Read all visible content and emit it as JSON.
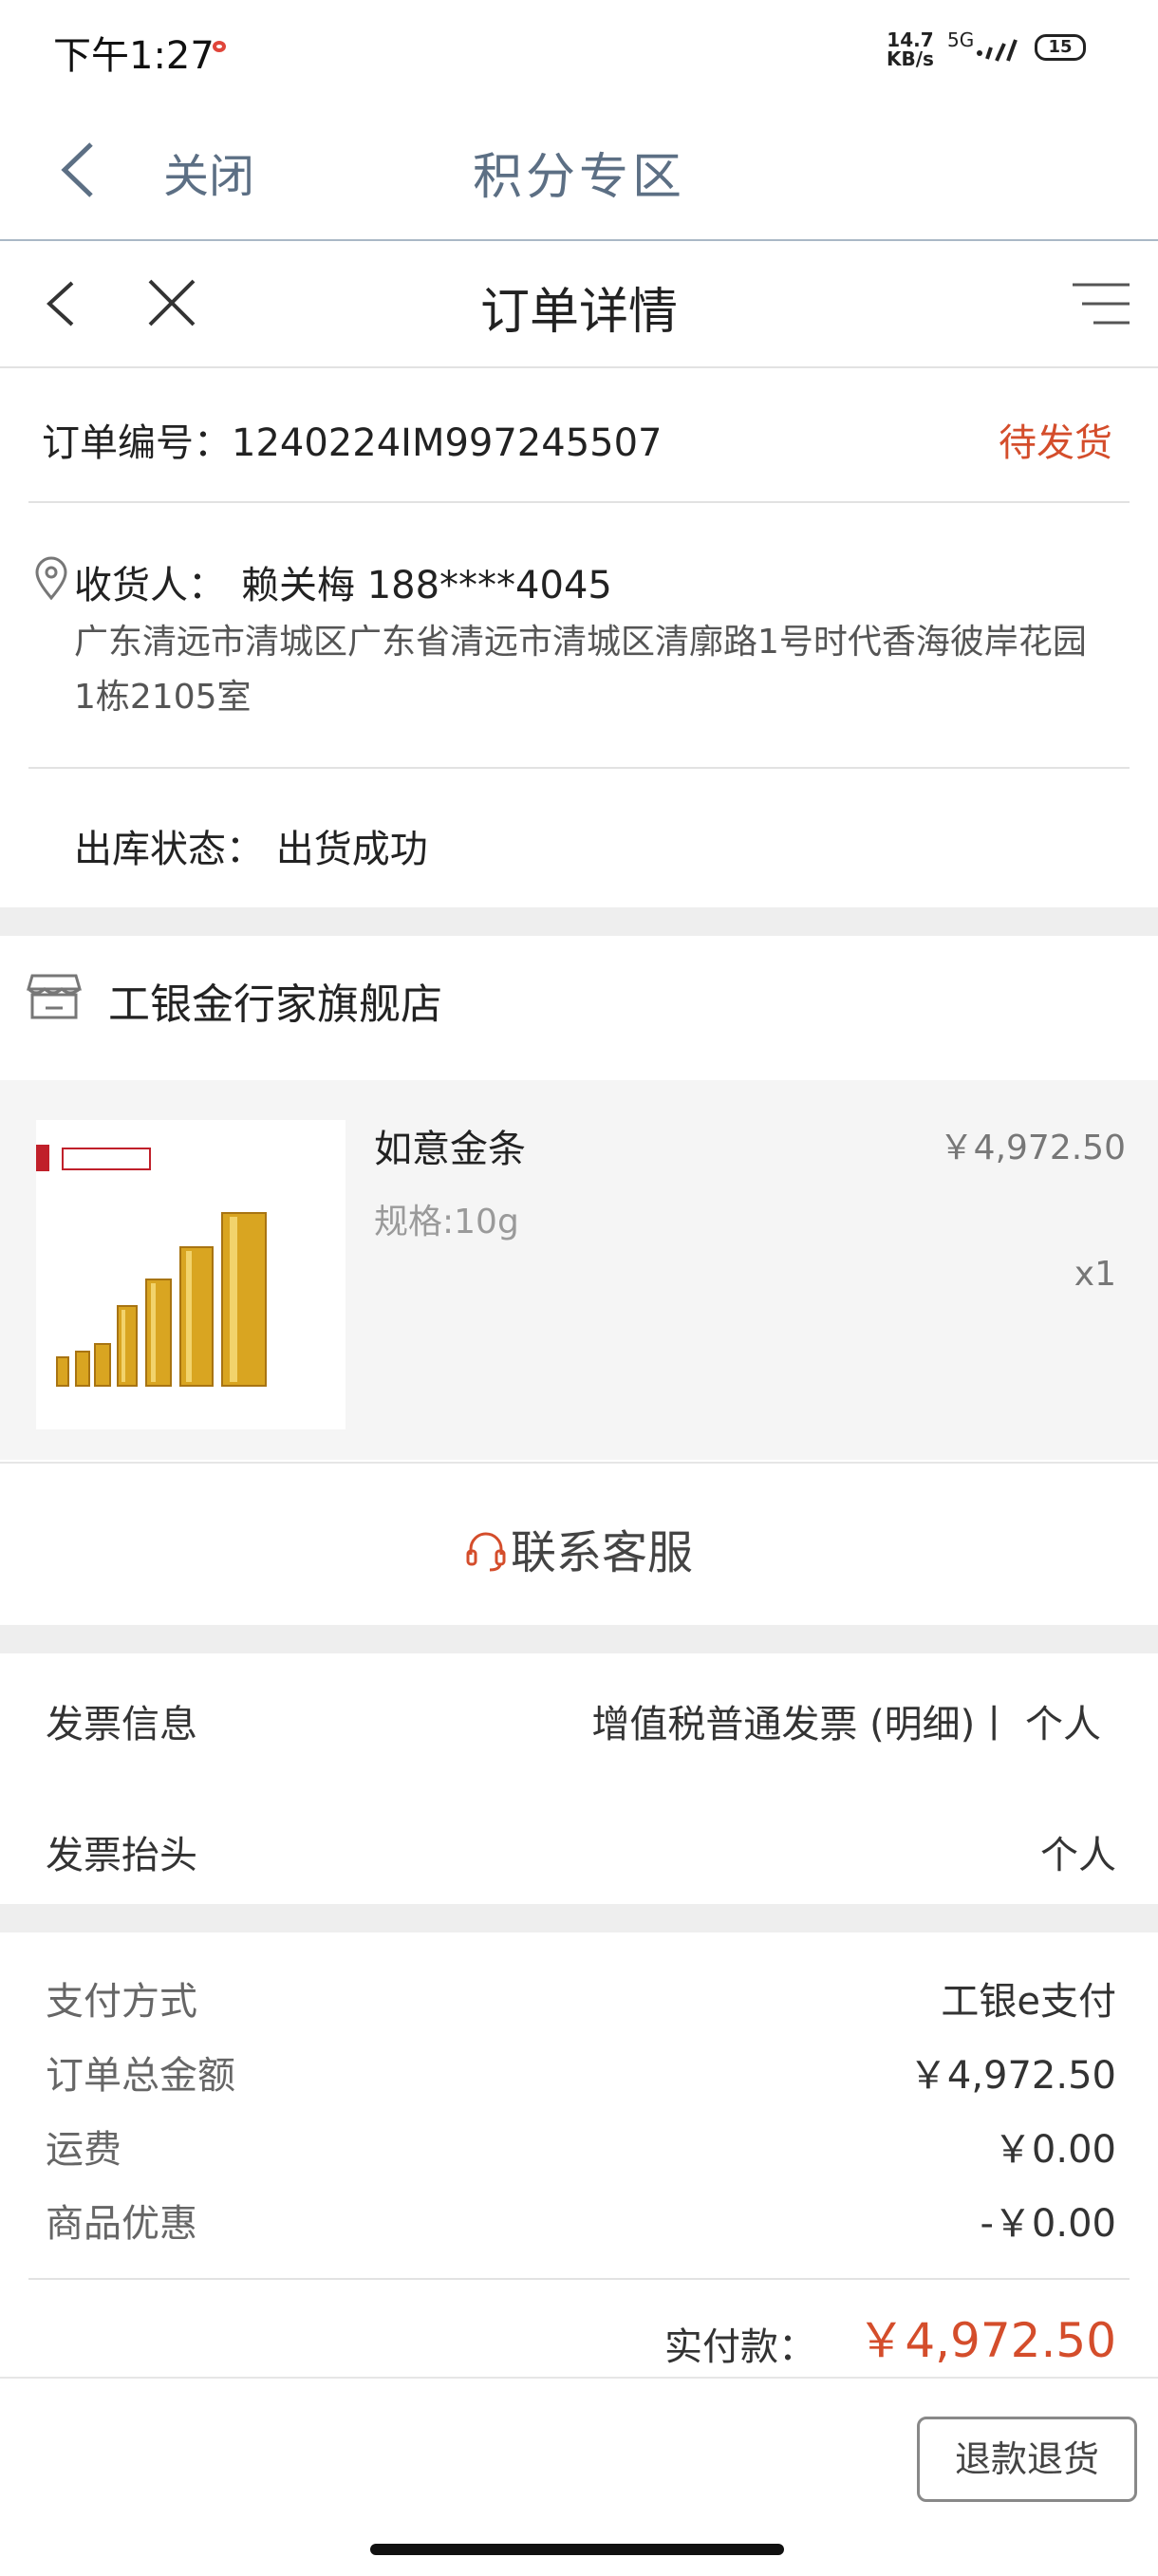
{
  "status_bar": {
    "time": "下午1:27",
    "net_speed_value": "14.7",
    "net_speed_unit": "KB/s",
    "network": "5G",
    "battery": "15"
  },
  "topbar": {
    "close_label": "关闭",
    "title": "积分专区"
  },
  "page": {
    "title": "订单详情"
  },
  "order": {
    "number_label": "订单编号：1240224IM997245507",
    "status": "待发货"
  },
  "receiver": {
    "label": "收货人：",
    "name_phone": "赖关梅 188****4045",
    "address": "广东清远市清城区广东省清远市清城区清廓路1号时代香海彼岸花园1栋2105室"
  },
  "warehouse": {
    "text": "出库状态：  出货成功"
  },
  "store": {
    "name": "工银金行家旗舰店"
  },
  "product": {
    "name": "如意金条",
    "spec": "规格:10g",
    "price": "￥4,972.50",
    "qty": "x1"
  },
  "service": {
    "label": "联系客服"
  },
  "invoice": {
    "info_label": "发票信息",
    "info_value": "增值税普通发票 (明细)丨 个人",
    "title_label": "发票抬头",
    "title_value": "个人"
  },
  "payment": {
    "rows": [
      {
        "label": "支付方式",
        "value": "工银e支付"
      },
      {
        "label": "订单总金额",
        "value": "￥4,972.50"
      },
      {
        "label": "运费",
        "value": "￥0.00"
      },
      {
        "label": "商品优惠",
        "value": "-￥0.00"
      }
    ],
    "actual_label": "实付款：",
    "actual_value": "￥4,972.50"
  },
  "actions": {
    "refund_label": "退款退货"
  },
  "colors": {
    "accent_red": "#d44d2b",
    "topbar_text": "#5c6f84"
  }
}
